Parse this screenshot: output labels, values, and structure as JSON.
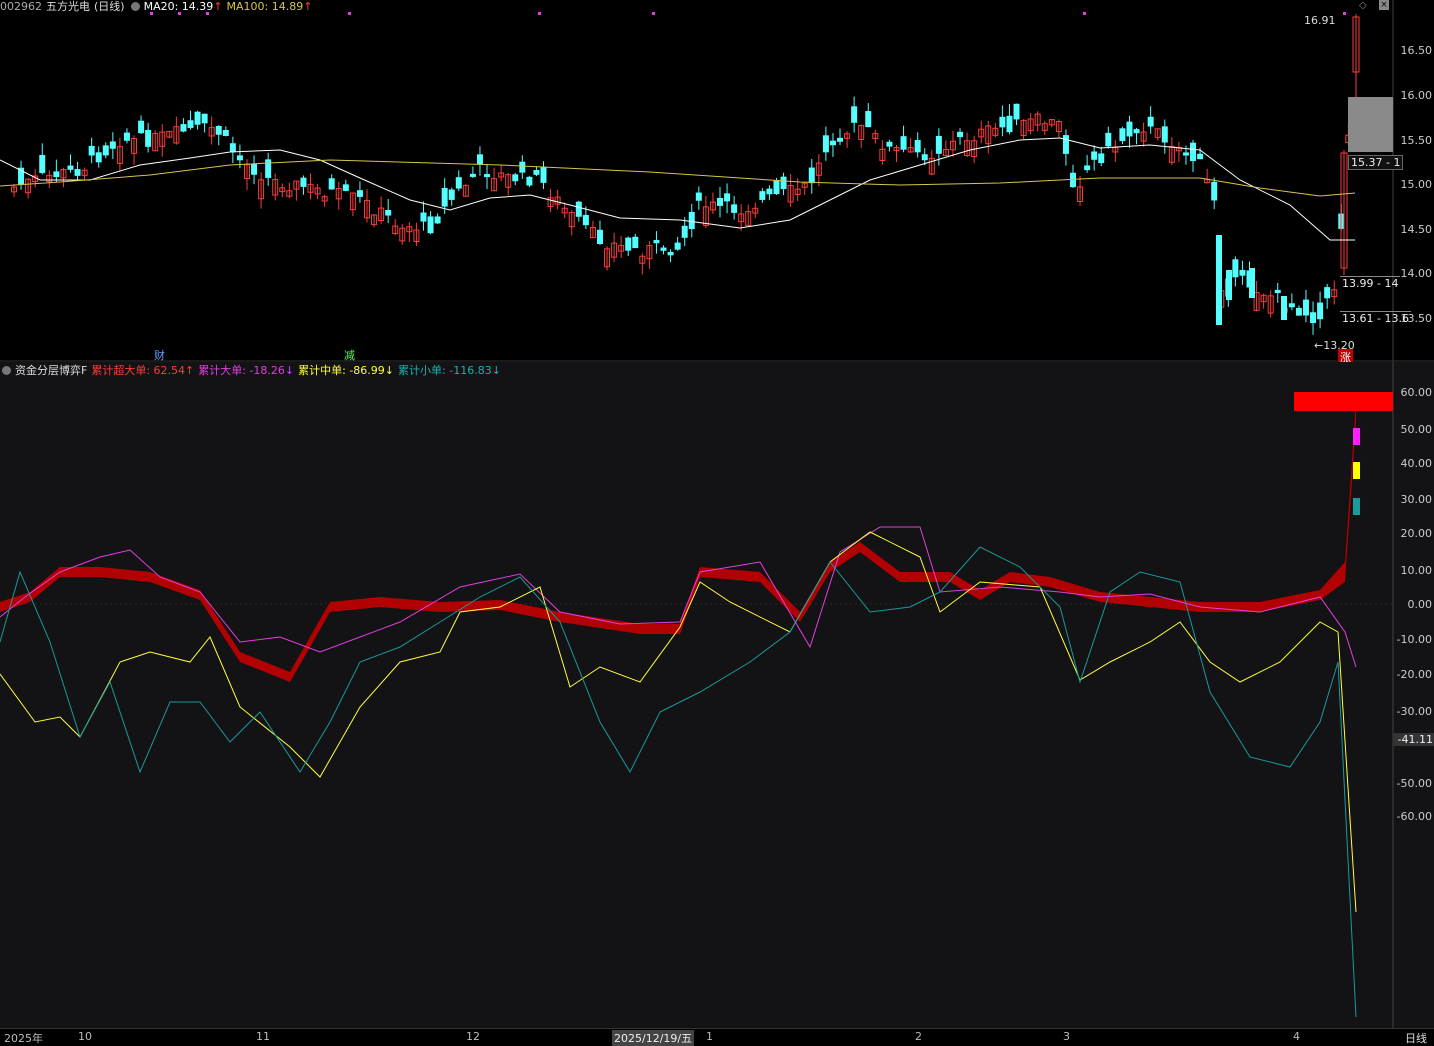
{
  "header": {
    "code": "002962",
    "name": "五方光电",
    "period": "(日线)",
    "ma20": "MA20: 14.39",
    "ma100": "MA100: 14.89"
  },
  "price_axis": [
    "16.50",
    "16.00",
    "15.50",
    "15.00",
    "14.50",
    "14.00",
    "13.50"
  ],
  "price_tags": {
    "high": "16.91",
    "low": "←13.20",
    "box1": "15.37 - 1",
    "box2": "13.99 - 14",
    "box3": "13.61 - 13.6"
  },
  "event_marks": {
    "cai": "财",
    "jian": "减",
    "zhang": "涨"
  },
  "indicator": {
    "name": "资金分层博弈F",
    "super": "累计超大单: 62.54↑",
    "big": "累计大单: -18.26↓",
    "mid": "累计中单: -86.99↓",
    "small": "累计小单: -116.83↓",
    "axis": [
      "60.00",
      "50.00",
      "40.00",
      "30.00",
      "20.00",
      "10.00",
      "0.00",
      "-10.00",
      "-20.00",
      "-30.00",
      "-50.00",
      "-60.00"
    ],
    "cursor_value": "-41.11"
  },
  "xaxis": [
    "2025年",
    "10",
    "11",
    "12",
    "2025/12/19/五",
    "1",
    "2",
    "3",
    "4"
  ],
  "corner": "日线",
  "colors": {
    "up": "#ff3b3b",
    "down": "#54ffff",
    "ma20": "#ffffff",
    "ma100": "#d6c64a",
    "super": "#c40000",
    "big": "#e040e0",
    "mid": "#ffff40",
    "small": "#1a9a9a"
  }
}
